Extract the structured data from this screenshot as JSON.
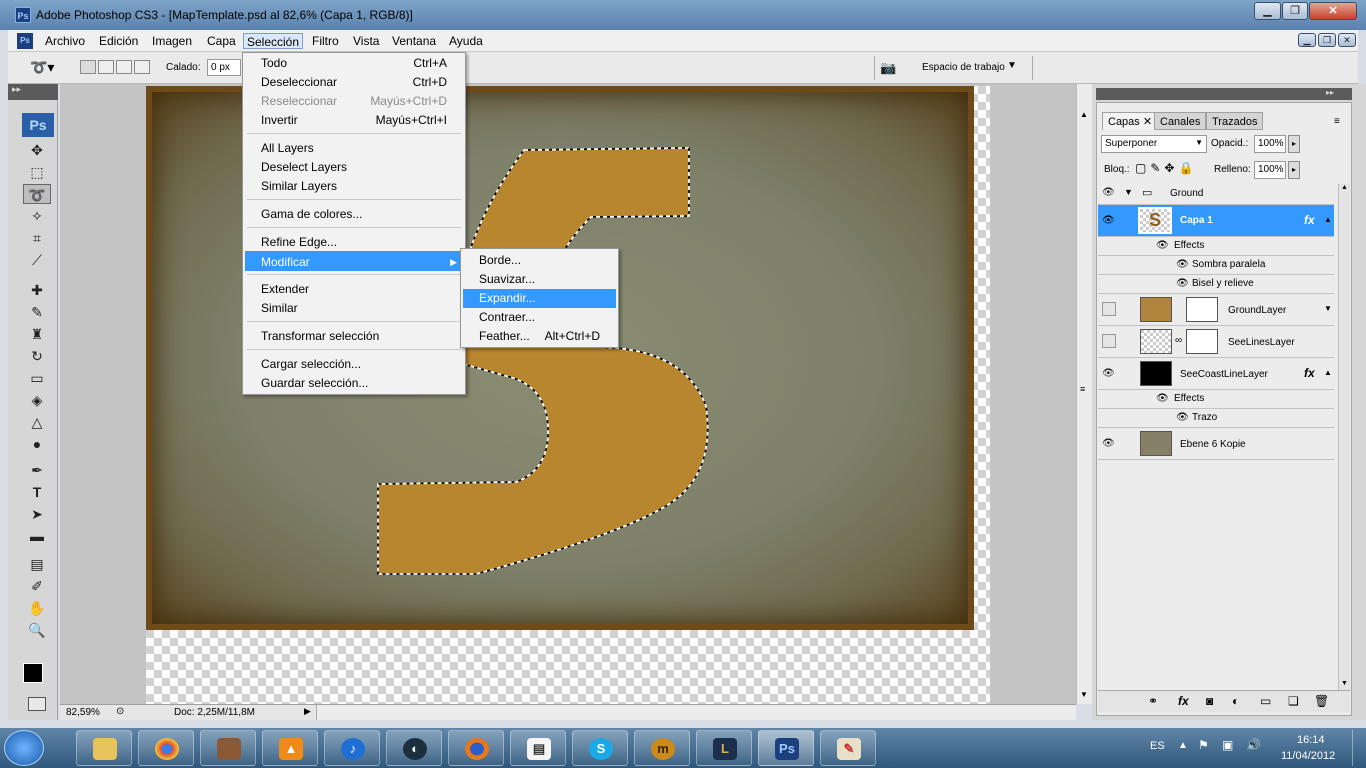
{
  "window": {
    "title": "Adobe Photoshop CS3 - [MapTemplate.psd al 82,6% (Capa 1, RGB/8)]",
    "app_badge": "Ps"
  },
  "menubar": [
    "Archivo",
    "Edición",
    "Imagen",
    "Capa",
    "Selección",
    "Filtro",
    "Vista",
    "Ventana",
    "Ayuda"
  ],
  "options": {
    "calado_label": "Calado:",
    "calado_value": "0 px",
    "workspace": "Espacio de trabajo"
  },
  "seleccion_menu": [
    {
      "label": "Todo",
      "shortcut": "Ctrl+A"
    },
    {
      "label": "Deseleccionar",
      "shortcut": "Ctrl+D"
    },
    {
      "label": "Reseleccionar",
      "shortcut": "Mayús+Ctrl+D"
    },
    {
      "label": "Invertir",
      "shortcut": "Mayús+Ctrl+I"
    },
    {
      "label": "All Layers",
      "shortcut": ""
    },
    {
      "label": "Deselect Layers",
      "shortcut": ""
    },
    {
      "label": "Similar Layers",
      "shortcut": ""
    },
    {
      "label": "Gama de colores...",
      "shortcut": ""
    },
    {
      "label": "Refine Edge...",
      "shortcut": ""
    },
    {
      "label": "Modificar",
      "shortcut": ""
    },
    {
      "label": "Extender",
      "shortcut": ""
    },
    {
      "label": "Similar",
      "shortcut": ""
    },
    {
      "label": "Transformar selección",
      "shortcut": ""
    },
    {
      "label": "Cargar selección...",
      "shortcut": ""
    },
    {
      "label": "Guardar selección...",
      "shortcut": ""
    }
  ],
  "modificar_submenu": [
    {
      "label": "Borde...",
      "shortcut": ""
    },
    {
      "label": "Suavizar...",
      "shortcut": ""
    },
    {
      "label": "Expandir...",
      "shortcut": ""
    },
    {
      "label": "Contraer...",
      "shortcut": ""
    },
    {
      "label": "Feather...",
      "shortcut": "Alt+Ctrl+D"
    }
  ],
  "status": {
    "zoom": "82,59%",
    "doc": "Doc: 2,25M/11,8M"
  },
  "layers": {
    "tabs": [
      "Capas",
      "Canales",
      "Trazados"
    ],
    "blend_mode": "Superponer",
    "opacity_label": "Opacid.:",
    "opacity": "100%",
    "lock_label": "Bloq.:",
    "fill_label": "Relleno:",
    "fill": "100%",
    "group": "Ground",
    "capa1": "Capa 1",
    "effects": "Effects",
    "sombra": "Sombra paralela",
    "bisel": "Bisel y relieve",
    "ground_layer": "GroundLayer",
    "see_lines": "SeeLinesLayer",
    "coast": "SeeCoastLineLayer",
    "effects2": "Effects",
    "trazo": "Trazo",
    "ebene": "Ebene 6 Kopie"
  },
  "taskbar": {
    "lang": "ES",
    "time": "16:14",
    "date": "11/04/2012"
  },
  "colors": {
    "selection_highlight": "#3399ff",
    "active_layer": "#3399ff"
  }
}
